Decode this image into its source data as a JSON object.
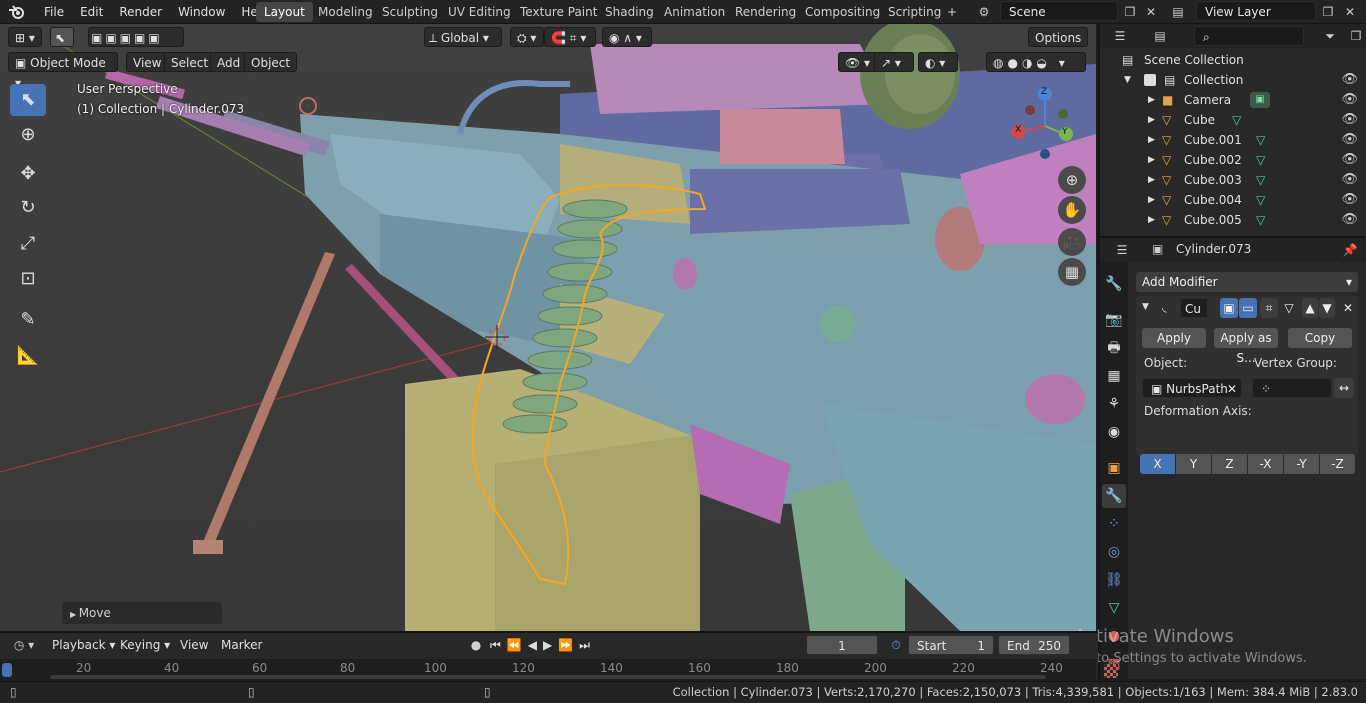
{
  "app": {
    "logo_icon": "blender-logo-icon"
  },
  "menu": [
    "File",
    "Edit",
    "Render",
    "Window",
    "Help"
  ],
  "workspaces": [
    "Layout",
    "Modeling",
    "Sculpting",
    "UV Editing",
    "Texture Paint",
    "Shading",
    "Animation",
    "Rendering",
    "Compositing",
    "Scripting"
  ],
  "active_workspace": "Layout",
  "add_workspace": "+",
  "scene": {
    "name": "Scene",
    "view_layer": "View Layer"
  },
  "tool_header": {
    "orientation": "Global",
    "options": "Options"
  },
  "viewport_header": {
    "mode": "Object Mode",
    "menus": [
      "View",
      "Select",
      "Add",
      "Object"
    ]
  },
  "viewport": {
    "perspective": "User Perspective",
    "collection_info": "(1) Collection | Cylinder.073",
    "operator_panel": "Move",
    "gizmo": {
      "x": "X",
      "y": "Y",
      "z": "Z"
    }
  },
  "outliner": {
    "root": "Scene Collection",
    "collection": "Collection",
    "items": [
      "Camera",
      "Cube",
      "Cube.001",
      "Cube.002",
      "Cube.003",
      "Cube.004",
      "Cube.005"
    ]
  },
  "properties": {
    "object_name": "Cylinder.073",
    "add_modifier": "Add Modifier",
    "modifier_name": "Cu",
    "apply": "Apply",
    "apply_as_shape": "Apply as S...",
    "copy": "Copy",
    "object_label": "Object:",
    "object_value": "NurbsPath",
    "vertex_group_label": "Vertex Group:",
    "deformation_axis_label": "Deformation Axis:",
    "axes": [
      "X",
      "Y",
      "Z",
      "-X",
      "-Y",
      "-Z"
    ],
    "active_axis": "X"
  },
  "timeline": {
    "menus": [
      "Playback",
      "Keying",
      "View",
      "Marker"
    ],
    "current_frame": "1",
    "start_label": "Start",
    "start": "1",
    "end_label": "End",
    "end": "250",
    "ticks": [
      "20",
      "40",
      "60",
      "80",
      "100",
      "120",
      "140",
      "160",
      "180",
      "200",
      "220",
      "240"
    ]
  },
  "status": {
    "text": "Collection | Cylinder.073 | Verts:2,170,270 | Faces:2,150,073 | Tris:4,339,581 | Objects:1/163 | Mem: 384.4 MiB | 2.83.0"
  },
  "watermark": {
    "title": "Activate Windows",
    "subtitle": "Go to Settings to activate Windows."
  },
  "colors": {
    "accent": "#4772b3",
    "selection_outline": "#f5a623",
    "background": "#3b3b3b"
  }
}
